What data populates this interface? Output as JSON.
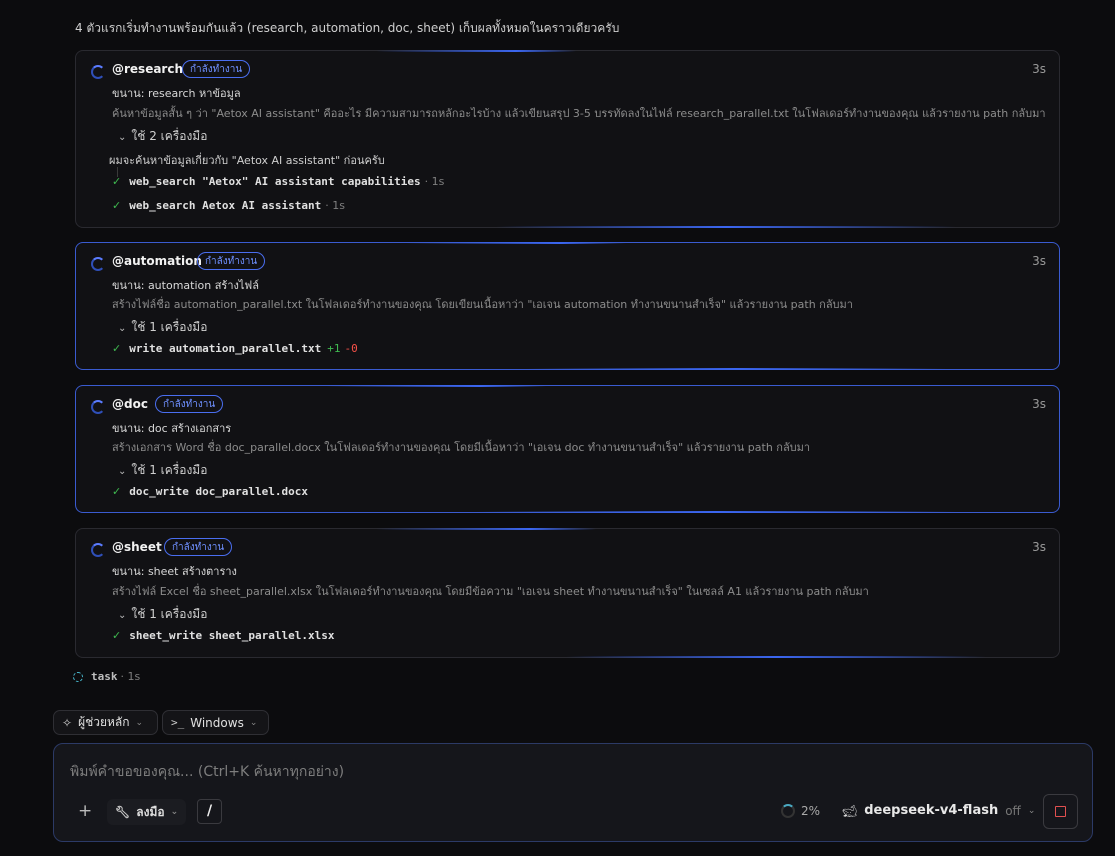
{
  "intro": "4 ตัวแรกเริ่มทำงานพร้อมกันแล้ว (research, automation, doc, sheet) เก็บผลทั้งหมดในคราวเดียวครับ",
  "agents": [
    {
      "name": "@research",
      "status": "กำลังทำงาน",
      "time": "3s",
      "subtitle": "ขนาน: research หาข้อมูล",
      "description": "ค้นหาข้อมูลสั้น ๆ ว่า \"Aetox AI assistant\" คืออะไร มีความสามารถหลักอะไรบ้าง แล้วเขียนสรุป 3-5 บรรทัดลงในไฟล์ research_parallel.txt ในโฟลเดอร์ทำงานของคุณ แล้วรายงาน path กลับมา",
      "tools_label": "ใช้ 2 เครื่องมือ",
      "thought": "ผมจะค้นหาข้อมูลเกี่ยวกับ \"Aetox AI assistant\" ก่อนครับ",
      "tools": [
        {
          "cmd": "web_search \"Aetox\" AI assistant capabilities",
          "duration": "· 1s"
        },
        {
          "cmd": "web_search Aetox AI assistant",
          "duration": "· 1s"
        }
      ]
    },
    {
      "name": "@automation",
      "status": "กำลังทำงาน",
      "time": "3s",
      "subtitle": "ขนาน: automation สร้างไฟล์",
      "description": "สร้างไฟล์ชื่อ automation_parallel.txt ในโฟลเดอร์ทำงานของคุณ โดยเขียนเนื้อหาว่า \"เอเจน automation ทำงานขนานสำเร็จ\" แล้วรายงาน path กลับมา",
      "tools_label": "ใช้ 1 เครื่องมือ",
      "tools": [
        {
          "cmd": "write automation_parallel.txt",
          "added": "+1",
          "removed": "-0"
        }
      ]
    },
    {
      "name": "@doc",
      "status": "กำลังทำงาน",
      "time": "3s",
      "subtitle": "ขนาน: doc สร้างเอกสาร",
      "description": "สร้างเอกสาร Word ชื่อ doc_parallel.docx ในโฟลเดอร์ทำงานของคุณ โดยมีเนื้อหาว่า \"เอเจน doc ทำงานขนานสำเร็จ\" แล้วรายงาน path กลับมา",
      "tools_label": "ใช้ 1 เครื่องมือ",
      "tools": [
        {
          "cmd": "doc_write doc_parallel.docx"
        }
      ]
    },
    {
      "name": "@sheet",
      "status": "กำลังทำงาน",
      "time": "3s",
      "subtitle": "ขนาน: sheet สร้างตาราง",
      "description": "สร้างไฟล์ Excel ชื่อ sheet_parallel.xlsx ในโฟลเดอร์ทำงานของคุณ โดยมีข้อความ \"เอเจน sheet ทำงานขนานสำเร็จ\" ในเซลล์ A1 แล้วรายงาน path กลับมา",
      "tools_label": "ใช้ 1 เครื่องมือ",
      "tools": [
        {
          "cmd": "sheet_write sheet_parallel.xlsx"
        }
      ]
    }
  ],
  "task": {
    "name": "task",
    "duration": "· 1s"
  },
  "chips": {
    "assistant": "ผู้ช่วยหลัก",
    "shell": "Windows"
  },
  "composer": {
    "placeholder": "พิมพ์คำขอของคุณ... (Ctrl+K ค้นหาทุกอย่าง)",
    "tools_label": "ลงมือ",
    "slash": "/",
    "context_pct": "2%",
    "model": "deepseek-v4-flash",
    "thinking": "off"
  },
  "colors": {
    "accent": "#3b66f0",
    "success": "#3fb950",
    "danger": "#f85149"
  }
}
